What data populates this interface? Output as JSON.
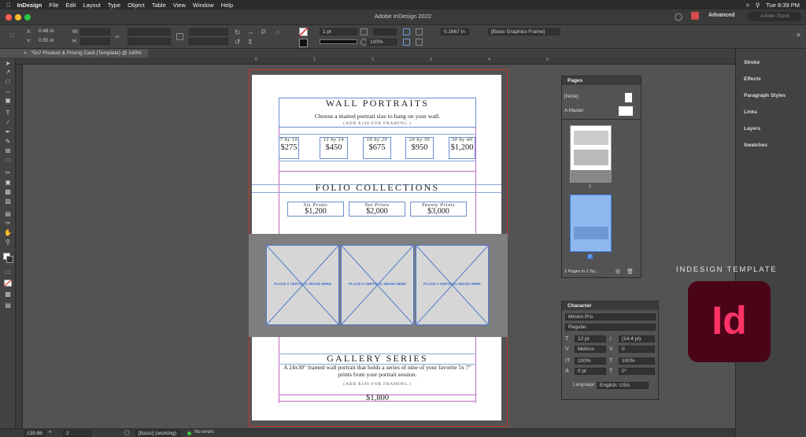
{
  "menubar": {
    "app": "InDesign",
    "items": [
      "File",
      "Edit",
      "Layout",
      "Type",
      "Object",
      "Table",
      "View",
      "Window",
      "Help"
    ],
    "clock": "Tue 8:39 PM"
  },
  "titlebar": {
    "title": "Adobe InDesign 2022",
    "workspace": "Advanced",
    "search_placeholder": "Adobe Stock"
  },
  "control": {
    "x_label": "X:",
    "x_value": "0.48 in",
    "y_label": "Y:",
    "y_value": "0.55 in",
    "w_label": "W:",
    "h_label": "H:",
    "stroke_weight": "1 pt",
    "opacity": "100%",
    "dimension": "0.1667 in",
    "object_style": "[Basic Graphics Frame]"
  },
  "document_tab": {
    "title": "*5x7 Product & Pricing Card (Template) @ 140%"
  },
  "ruler_ticks": [
    "0",
    "1",
    "2",
    "3",
    "4",
    "5"
  ],
  "status": {
    "zoom": "139.86",
    "page": "2",
    "style": "[Basic] (working)",
    "preflight": "No errors"
  },
  "card": {
    "wall_title": "WALL PORTRAITS",
    "wall_sub": "Choose a matted portrait size to hang on your wall.",
    "wall_note": "(ADD $100 FOR FRAMING.)",
    "sizes": [
      {
        "size": "7 by 10",
        "price": "$275"
      },
      {
        "size": "11 by 14",
        "price": "$450"
      },
      {
        "size": "16 by 20",
        "price": "$675"
      },
      {
        "size": "24 by 30",
        "price": "$950"
      },
      {
        "size": "30 by 40",
        "price": "$1,200"
      }
    ],
    "folio_title": "FOLIO COLLECTIONS",
    "folios": [
      {
        "name": "Six Prints",
        "price": "$1,200"
      },
      {
        "name": "Ten Prints",
        "price": "$2,000"
      },
      {
        "name": "Twenty Prints",
        "price": "$3,000"
      }
    ],
    "placeholder": "PLACE A VERTICAL IMAGE HERE",
    "placeholder_top": "",
    "gallery_title": "GALLERY SERIES",
    "gallery_desc": "A 24x30\" framed wall portrait that holds a series of nine of your favorite 5x 7\" prints from your portrait session.",
    "gallery_note": "(ADD $100 FOR FRAMING.)",
    "gallery_price": "$1,800"
  },
  "dock": {
    "items": [
      "Stroke",
      "Effects",
      "Paragraph Styles",
      "Links",
      "Layers",
      "Swatches"
    ]
  },
  "pages_panel": {
    "title": "Pages",
    "none_label": "[None]",
    "master_label": "A-Master",
    "thumb1_label": "1",
    "thumb2_label": "2",
    "footer": "2 Pages in 2 Sp..."
  },
  "character_panel": {
    "title": "Character",
    "font": "Minion Pro",
    "style": "Regular",
    "size": "12 pt",
    "leading": "(14.4 pt)",
    "kerning": "Metrics",
    "tracking": "0",
    "vscale": "100%",
    "hscale": "100%",
    "baseline": "0 pt",
    "skew": "0°",
    "language_label": "Language:",
    "language": "English: USA"
  },
  "overlay": {
    "template_label": "INDESIGN TEMPLATE",
    "logo_text": "Id"
  }
}
